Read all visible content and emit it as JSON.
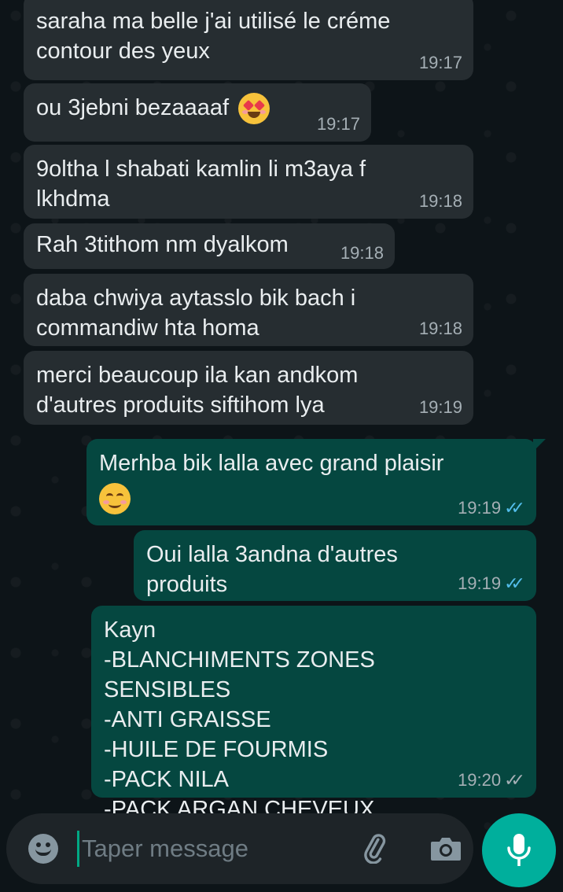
{
  "messages": [
    {
      "dir": "in",
      "text": "saraha ma belle j'ai utilisé le créme\ncontour des yeux",
      "time": "19:17"
    },
    {
      "dir": "in",
      "text": "ou 3jebni bezaaaaf",
      "emoji": "heart-eyes-emoji",
      "time": "19:17"
    },
    {
      "dir": "in",
      "text": "9oltha l shabati kamlin li m3aya f\nlkhdma",
      "time": "19:18"
    },
    {
      "dir": "in",
      "text": "Rah 3tithom nm dyalkom",
      "time": "19:18"
    },
    {
      "dir": "in",
      "text": "daba chwiya aytasslo bik bach i\ncommandiw hta homa",
      "time": "19:18"
    },
    {
      "dir": "in",
      "text": "merci beaucoup ila kan andkom\nd'autres produits siftihom lya",
      "time": "19:19"
    },
    {
      "dir": "out",
      "text": "Merhba bik lalla avec grand plaisir",
      "emoji": "smiling-blush-emoji",
      "time": "19:19",
      "status": "read"
    },
    {
      "dir": "out",
      "text": "Oui lalla 3andna d'autres produits",
      "time": "19:19",
      "status": "read"
    },
    {
      "dir": "out",
      "text": "Kayn\n-BLANCHIMENTS ZONES SENSIBLES\n-ANTI GRAISSE\n-HUILE DE FOURMIS\n-PACK NILA\n-PACK ARGAN CHEVEUX",
      "time": "19:20",
      "status": "delivered"
    }
  ],
  "composer": {
    "placeholder": "Taper message",
    "icons": [
      "emoji-icon",
      "attach-icon",
      "camera-icon",
      "mic-icon"
    ]
  },
  "colors": {
    "background": "#0d1418",
    "incoming_bubble": "#262d31",
    "outgoing_bubble": "#054740",
    "read_ticks": "#53bdeb",
    "accent": "#00af9c"
  }
}
